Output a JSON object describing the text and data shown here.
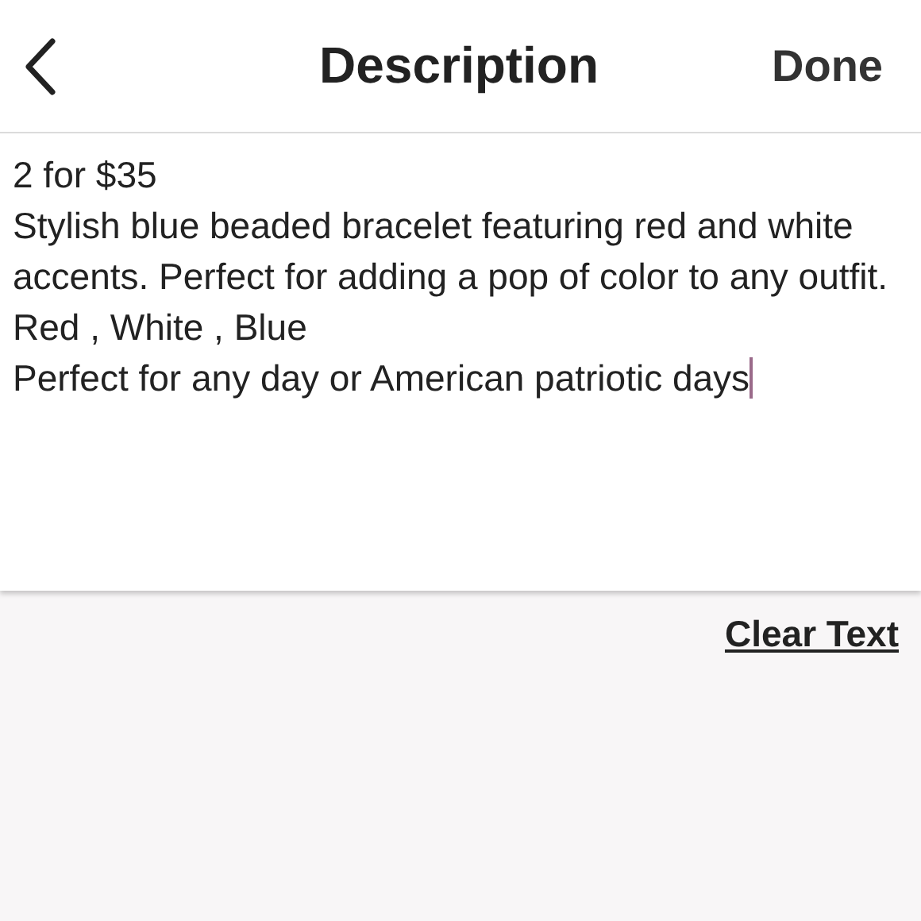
{
  "header": {
    "title": "Description",
    "done_button": "Done"
  },
  "description": {
    "value": "2 for $35\nStylish blue beaded bracelet featuring red and white accents. Perfect for adding a pop of color to any outfit.\nRed , White , Blue\nPerfect for any day or American patriotic days"
  },
  "clear_button": "Clear Text"
}
